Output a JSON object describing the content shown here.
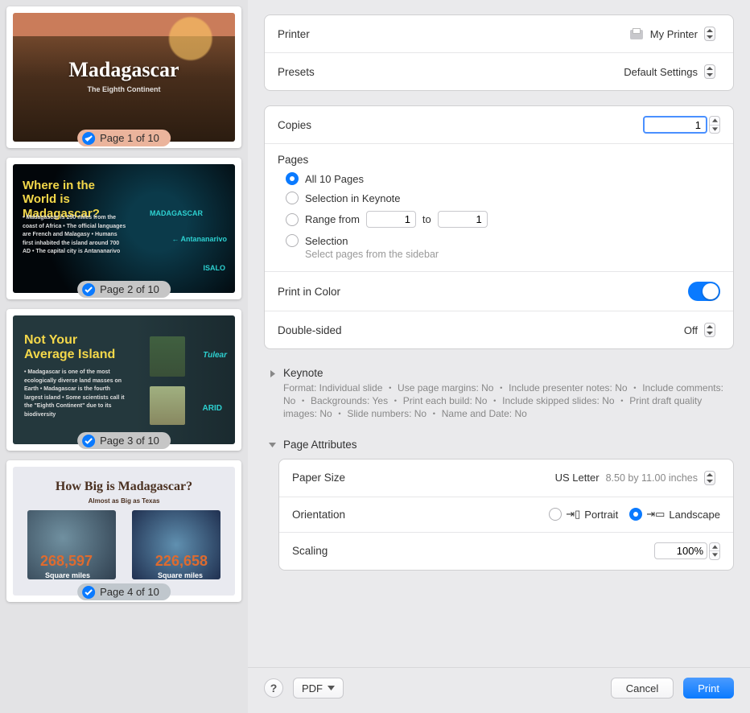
{
  "sidebar": {
    "thumbs": [
      {
        "label": "Page 1 of 10",
        "title": "Madagascar",
        "sub": "The Eighth Continent"
      },
      {
        "label": "Page 2 of 10",
        "title": "Where in the World is Madagascar?",
        "bullets": "• Madagascar is 250 miles from the coast of Africa\n• The official languages are French and Malagasy\n• Humans first inhabited the island around 700 AD\n• The capital city is Antananarivo",
        "note1": "MADAGASCAR",
        "note2": "← Antananarivo",
        "note3": "ISALO"
      },
      {
        "label": "Page 3 of 10",
        "title": "Not Your Average Island",
        "bullets": "• Madagascar is one of the most ecologically diverse land masses on Earth\n• Madagascar is the fourth largest island\n• Some scientists call it the \"Eighth Continent\" due to its biodiversity",
        "lab1": "Tulear",
        "lab2": "ARID"
      },
      {
        "label": "Page 4 of 10",
        "title": "How Big is Madagascar?",
        "sub": "Almost as Big as Texas",
        "num1": "268,597",
        "num2": "226,658",
        "numsub": "Square miles"
      }
    ]
  },
  "printer": {
    "label": "Printer",
    "value": "My Printer"
  },
  "presets": {
    "label": "Presets",
    "value": "Default Settings"
  },
  "copies": {
    "label": "Copies",
    "value": "1"
  },
  "pages": {
    "label": "Pages",
    "all": "All 10 Pages",
    "selection_app": "Selection in Keynote",
    "range": "Range from",
    "range_to": "to",
    "range_from_val": "1",
    "range_to_val": "1",
    "selection": "Selection",
    "selection_hint": "Select pages from the sidebar"
  },
  "color": {
    "label": "Print in Color"
  },
  "double": {
    "label": "Double-sided",
    "value": "Off"
  },
  "keynote": {
    "title": "Keynote",
    "desc": "Format: Individual slide ・ Use page margins: No ・ Include presenter notes: No ・ Include comments: No ・ Backgrounds: Yes ・ Print each build: No ・ Include skipped slides: No ・ Print draft quality images: No ・ Slide numbers: No ・ Name and Date: No"
  },
  "page_attrs": {
    "title": "Page Attributes",
    "paper": {
      "label": "Paper Size",
      "value": "US Letter",
      "dim": "8.50 by 11.00 inches"
    },
    "orientation": {
      "label": "Orientation",
      "portrait": "Portrait",
      "landscape": "Landscape"
    },
    "scaling": {
      "label": "Scaling",
      "value": "100%"
    }
  },
  "footer": {
    "pdf": "PDF",
    "cancel": "Cancel",
    "print": "Print"
  }
}
